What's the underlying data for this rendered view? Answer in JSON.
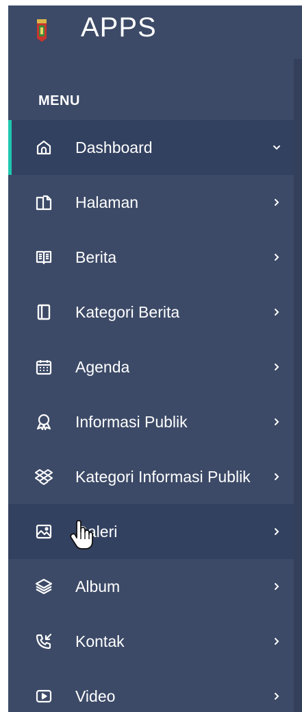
{
  "brand": {
    "title": "APPS",
    "logo_icon": "regional-emblem-icon"
  },
  "menu": {
    "header": "MENU",
    "items": [
      {
        "label": "Dashboard",
        "icon": "home-icon",
        "chevron": "chevron-down-icon",
        "active": true
      },
      {
        "label": "Halaman",
        "icon": "pages-icon",
        "chevron": "chevron-right-icon"
      },
      {
        "label": "Berita",
        "icon": "news-book-icon",
        "chevron": "chevron-right-icon"
      },
      {
        "label": "Kategori Berita",
        "icon": "category-book-icon",
        "chevron": "chevron-right-icon"
      },
      {
        "label": "Agenda",
        "icon": "calendar-icon",
        "chevron": "chevron-right-icon"
      },
      {
        "label": "Informasi Publik",
        "icon": "award-ribbon-icon",
        "chevron": "chevron-right-icon"
      },
      {
        "label": "Kategori Informasi Publik",
        "icon": "dropbox-icon",
        "chevron": "chevron-right-icon"
      },
      {
        "label": "Galeri",
        "icon": "image-icon",
        "chevron": "chevron-right-icon",
        "hover": true
      },
      {
        "label": "Album",
        "icon": "layers-icon",
        "chevron": "chevron-right-icon"
      },
      {
        "label": "Kontak",
        "icon": "phone-incoming-icon",
        "chevron": "chevron-right-icon"
      },
      {
        "label": "Video",
        "icon": "play-icon",
        "chevron": "chevron-right-icon"
      }
    ]
  },
  "colors": {
    "sidebar_bg": "#3c4a67",
    "active_bg": "#334160",
    "active_accent": "#1fc7b0",
    "text": "#ffffff"
  }
}
